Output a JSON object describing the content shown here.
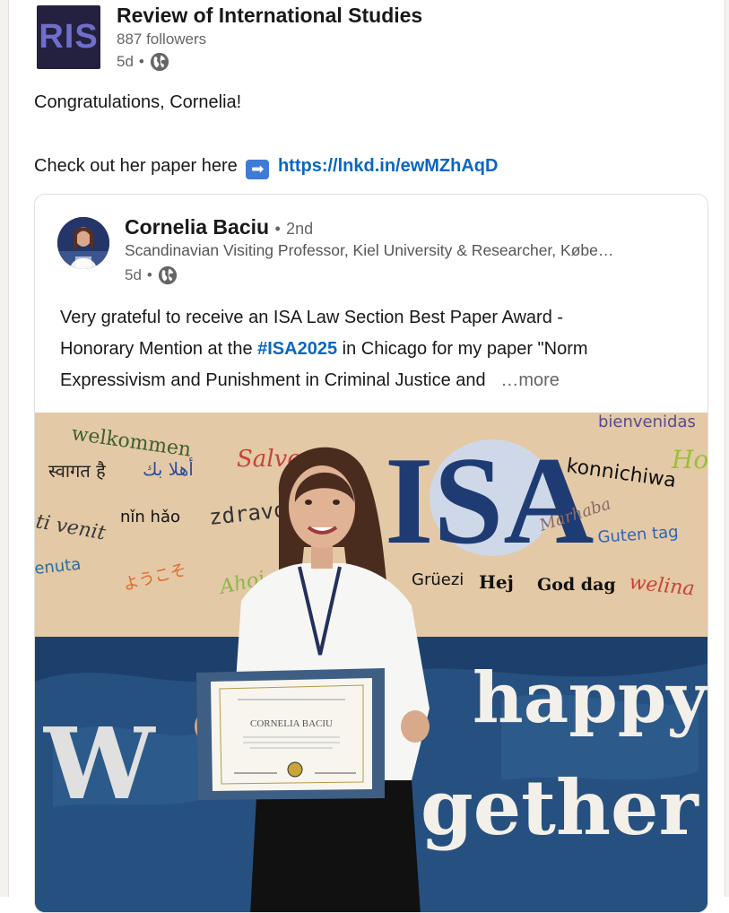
{
  "org": {
    "logo_text": "RIS",
    "name": "Review of International Studies",
    "followers": "887 followers",
    "time": "5d",
    "separator": "•",
    "visibility_icon": "globe-icon"
  },
  "post": {
    "line1": "Congratulations, Cornelia!",
    "line2_prefix": "Check out her paper here",
    "arrow_icon": "➡",
    "link": "https://lnkd.in/ewMZhAqD"
  },
  "shared": {
    "author": "Cornelia Baciu",
    "degree": "2nd",
    "degree_separator": "•",
    "headline": "Scandinavian Visiting Professor, Kiel University & Researcher, Købe…",
    "time": "5d",
    "separator": "•",
    "text_line1": "Very grateful to receive an ISA Law Section Best Paper Award -",
    "text_line2_a": "Honorary Mention at the ",
    "hashtag": "#ISA2025",
    "text_line2_b": " in Chicago for my paper \"Norm",
    "text_line3": "Expressivism and Punishment in Criminal Justice and",
    "more": "…more"
  },
  "photo": {
    "banner_big": "ISA",
    "welcome": [
      "welkommen",
      "स्वागत है",
      "أهلا بك",
      "Salve",
      "bienvenidas",
      "konnichiwa",
      "Ho",
      "ti venit",
      "nǐn hǎo",
      "zdravo",
      "Marhaba",
      "Guten tag",
      "enuta",
      "ようこそ",
      "Ahoj",
      "Grüezi",
      "Hej",
      "God dag",
      "welina"
    ],
    "slogan_1": "happy",
    "slogan_2": "gether!",
    "certificate_name": "CORNELIA BACIU",
    "colors": {
      "banner_bg": "#e3c9a6",
      "map_bg": "#1d3f6b",
      "isa_blue": "#1f3b73"
    }
  }
}
